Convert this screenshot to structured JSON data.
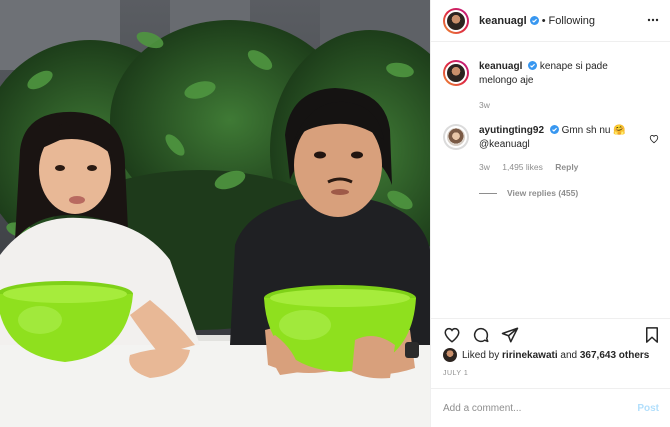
{
  "post": {
    "author": "keanuagl",
    "follow_state": "Following",
    "separator": "•"
  },
  "comments": [
    {
      "user": "keanuagl",
      "text": "kenape si pade melongo aje",
      "time": "3w"
    },
    {
      "user": "ayutingting92",
      "text": "Gmn sh nu 🤗 @keanuagl",
      "time": "3w",
      "likes": "1,495 likes",
      "reply_label": "Reply",
      "view_replies": "View replies (455)"
    }
  ],
  "liked_by": {
    "prefix": "Liked by",
    "user": "ririnekawati",
    "middle": "and",
    "count": "367,643 others"
  },
  "date": "JULY 1",
  "add_comment": {
    "placeholder": "Add a comment...",
    "post_label": "Post"
  },
  "icons": {
    "more": "more-horizontal-icon",
    "verified": "verified-badge-icon",
    "like": "heart-icon",
    "comment": "comment-icon",
    "share": "share-icon",
    "save": "bookmark-icon"
  },
  "colors": {
    "verified_blue": "#3897f0",
    "muted_text": "#8e8e8e",
    "post_button_disabled": "#b2dffc",
    "basin_green": "#8fe01e"
  }
}
